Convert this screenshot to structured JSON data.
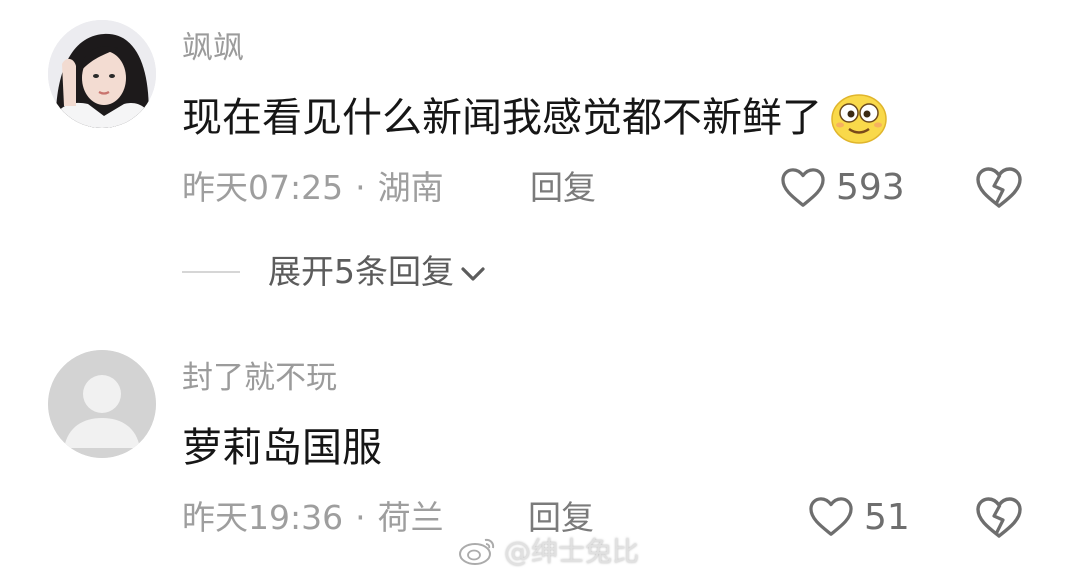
{
  "comments": [
    {
      "username": "飒飒",
      "content": "现在看见什么新闻我感觉都不新鲜了",
      "emoji": "silly-face-emoji",
      "time": "昨天07:25",
      "separator": "·",
      "location": "湖南",
      "reply_label": "回复",
      "like_count": "593",
      "avatar": "user-photo-avatar"
    },
    {
      "username": "封了就不玩",
      "content": "萝莉岛国服",
      "time": "昨天19:36",
      "separator": "·",
      "location": "荷兰",
      "reply_label": "回复",
      "like_count": "51",
      "avatar": "default-gray-avatar"
    }
  ],
  "expand_replies": {
    "label": "展开5条回复",
    "icon": "chevron-down-icon"
  },
  "watermark": {
    "text": "@绅士兔比",
    "icon": "weibo-logo"
  },
  "colors": {
    "username": "#9b9b9b",
    "content": "#161616",
    "meta": "#9e9e9e",
    "emoji_face": "#f9d94a"
  }
}
